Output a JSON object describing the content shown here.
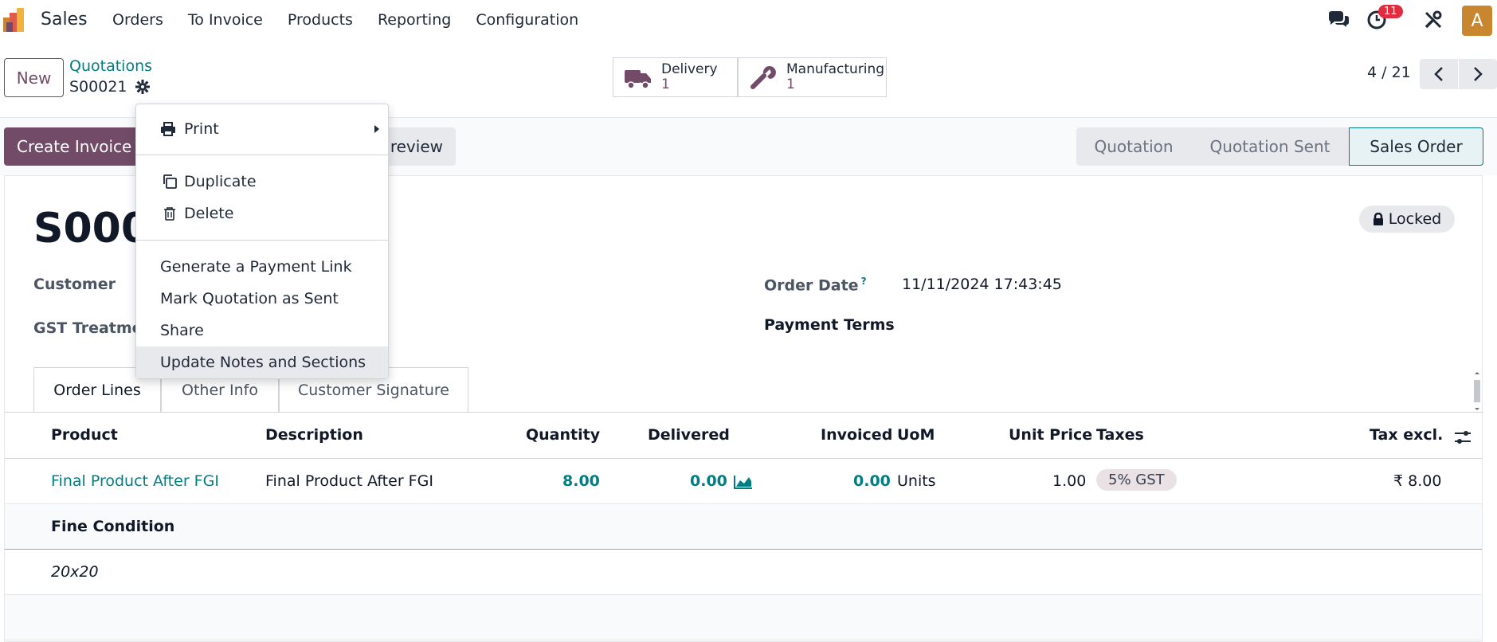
{
  "navbar": {
    "app_name": "Sales",
    "menu": [
      "Orders",
      "To Invoice",
      "Products",
      "Reporting",
      "Configuration"
    ],
    "activity_count": "11",
    "avatar_letter": "A"
  },
  "control": {
    "new_label": "New",
    "breadcrumb_parent": "Quotations",
    "breadcrumb_current": "S00021",
    "smart_buttons": [
      {
        "title": "Delivery",
        "value": "1",
        "icon": "truck-icon"
      },
      {
        "title": "Manufacturing",
        "value": "1",
        "icon": "wrench-icon"
      }
    ],
    "pager": "4 / 21"
  },
  "actions": {
    "create_invoice": "Create Invoice",
    "preview": "review",
    "statuses": [
      "Quotation",
      "Quotation Sent",
      "Sales Order"
    ],
    "active_status": "Sales Order"
  },
  "record": {
    "name": "S0002",
    "locked_label": "Locked",
    "fields": {
      "customer_label": "Customer",
      "gst_label": "GST Treatmen",
      "order_date_label": "Order Date",
      "order_date_help": "?",
      "order_date_value": "11/11/2024 17:43:45",
      "payment_terms_label": "Payment Terms"
    },
    "tabs": [
      "Order Lines",
      "Other Info",
      "Customer Signature"
    ],
    "active_tab": "Order Lines"
  },
  "table": {
    "headers": [
      "Product",
      "Description",
      "Quantity",
      "Delivered",
      "Invoiced",
      "UoM",
      "Unit Price",
      "Taxes",
      "Tax excl."
    ],
    "line": {
      "product": "Final Product After FGI",
      "description": "Final Product After FGI",
      "quantity": "8.00",
      "delivered": "0.00",
      "invoiced": "0.00",
      "uom": "Units",
      "unit_price": "1.00",
      "tax": "5% GST",
      "subtotal": "₹ 8.00"
    },
    "section": "Fine Condition",
    "note": "20x20"
  },
  "dropdown": {
    "print": "Print",
    "duplicate": "Duplicate",
    "delete": "Delete",
    "payment_link": "Generate a Payment Link",
    "mark_sent": "Mark Quotation as Sent",
    "share": "Share",
    "update_notes": "Update Notes and Sections"
  },
  "colors": {
    "brand": "#714b67",
    "link": "#017e84",
    "badge": "#e02c3e"
  }
}
